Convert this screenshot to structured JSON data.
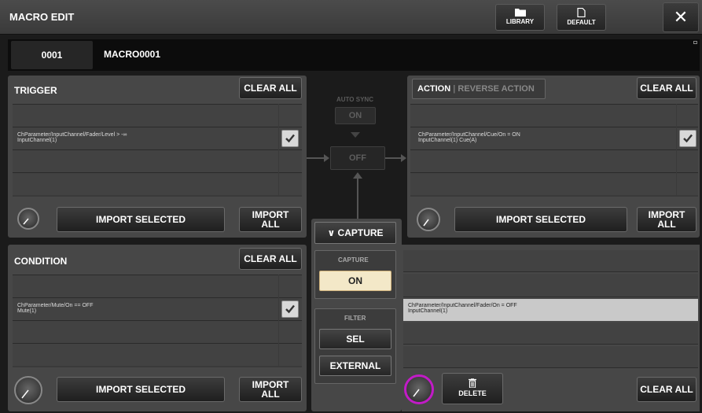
{
  "header": {
    "title": "MACRO EDIT",
    "library_label": "LIBRARY",
    "default_label": "DEFAULT",
    "close_label": "✕"
  },
  "macro": {
    "number": "0001",
    "name": "MACRO0001"
  },
  "trigger": {
    "title": "TRIGGER",
    "clear_all_label": "CLEAR ALL",
    "import_selected_label": "IMPORT SELECTED",
    "import_all_label_1": "IMPORT",
    "import_all_label_2": "ALL",
    "rows": [
      {
        "line1": "",
        "line2": "",
        "checked": false
      },
      {
        "line1": "ChParameter/InputChannel/Fader/Level > -∞",
        "line2": "InputChannel(1)",
        "checked": true
      },
      {
        "line1": "",
        "line2": "",
        "checked": false
      },
      {
        "line1": "",
        "line2": "",
        "checked": false
      }
    ]
  },
  "center": {
    "auto_sync_label": "AUTO SYNC",
    "auto_sync_value": "ON",
    "off_label": "OFF",
    "capture_toggle_label": "CAPTURE",
    "capture_section_label": "CAPTURE",
    "capture_on_label": "ON",
    "filter_label": "FILTER",
    "sel_label": "SEL",
    "external_label": "EXTERNAL"
  },
  "action": {
    "tab_action": "ACTION",
    "tab_reverse": "REVERSE ACTION",
    "clear_all_label": "CLEAR ALL",
    "import_selected_label": "IMPORT SELECTED",
    "import_all_label_1": "IMPORT",
    "import_all_label_2": "ALL",
    "rows": [
      {
        "line1": "",
        "line2": "",
        "checked": false
      },
      {
        "line1": "ChParameter/InputChannel/Cue/On = ON",
        "line2": "InputChannel(1) Cue(A)",
        "checked": true
      },
      {
        "line1": "",
        "line2": "",
        "checked": false
      },
      {
        "line1": "",
        "line2": "",
        "checked": false
      }
    ]
  },
  "condition": {
    "title": "CONDITION",
    "clear_all_label": "CLEAR ALL",
    "import_selected_label": "IMPORT SELECTED",
    "import_all_label_1": "IMPORT",
    "import_all_label_2": "ALL",
    "rows": [
      {
        "line1": "",
        "line2": "",
        "checked": false
      },
      {
        "line1": "ChParameter/Mute/On == OFF",
        "line2": "Mute(1)",
        "checked": true
      },
      {
        "line1": "",
        "line2": "",
        "checked": false
      },
      {
        "line1": "",
        "line2": "",
        "checked": false
      }
    ]
  },
  "capture_list": {
    "rows": [
      {
        "line1": "",
        "line2": ""
      },
      {
        "line1": "",
        "line2": ""
      },
      {
        "line1": "ChParameter/InputChannel/Fader/On = OFF",
        "line2": "InputChannel(1)",
        "selected": true
      },
      {
        "line1": "",
        "line2": ""
      },
      {
        "line1": "",
        "line2": ""
      }
    ],
    "delete_label": "DELETE",
    "clear_all_label": "CLEAR ALL"
  },
  "colors": {
    "accent_knob": "#c21bc7",
    "capture_on_bg": "#f3e8c8",
    "selected_row": "#c9c9c9"
  }
}
